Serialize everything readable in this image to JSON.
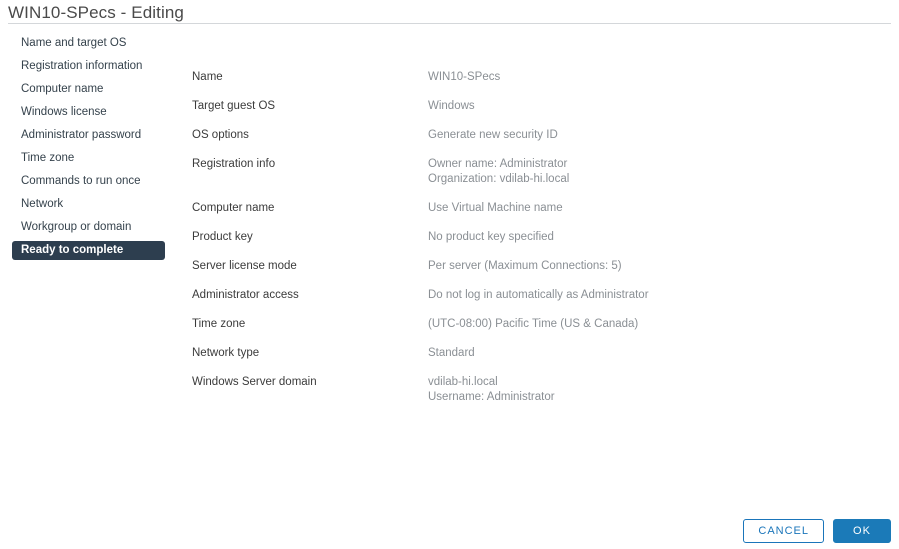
{
  "header": {
    "title": "WIN10-SPecs - Editing"
  },
  "sidebar": {
    "items": [
      {
        "label": "Name and target OS",
        "selected": false
      },
      {
        "label": "Registration information",
        "selected": false
      },
      {
        "label": "Computer name",
        "selected": false
      },
      {
        "label": "Windows license",
        "selected": false
      },
      {
        "label": "Administrator password",
        "selected": false
      },
      {
        "label": "Time zone",
        "selected": false
      },
      {
        "label": "Commands to run once",
        "selected": false
      },
      {
        "label": "Network",
        "selected": false
      },
      {
        "label": "Workgroup or domain",
        "selected": false
      },
      {
        "label": "Ready to complete",
        "selected": true
      }
    ]
  },
  "summary": {
    "rows": [
      {
        "label": "Name",
        "value": "WIN10-SPecs",
        "value2": ""
      },
      {
        "label": "Target guest OS",
        "value": "Windows",
        "value2": ""
      },
      {
        "label": "OS options",
        "value": "Generate new security ID",
        "value2": ""
      },
      {
        "label": "Registration info",
        "value": "Owner name: Administrator",
        "value2": "Organization: vdilab-hi.local"
      },
      {
        "label": "Computer name",
        "value": "Use Virtual Machine name",
        "value2": ""
      },
      {
        "label": "Product key",
        "value": "No product key specified",
        "value2": ""
      },
      {
        "label": "Server license mode",
        "value": "Per server (Maximum Connections: 5)",
        "value2": ""
      },
      {
        "label": "Administrator access",
        "value": "Do not log in automatically as Administrator",
        "value2": ""
      },
      {
        "label": "Time zone",
        "value": "(UTC-08:00) Pacific Time (US & Canada)",
        "value2": ""
      },
      {
        "label": "Network type",
        "value": "Standard",
        "value2": ""
      },
      {
        "label": "Windows Server domain",
        "value": "vdilab-hi.local",
        "value2": "Username: Administrator"
      }
    ]
  },
  "footer": {
    "cancel_label": "CANCEL",
    "ok_label": "OK"
  },
  "colors": {
    "primary": "#1b7ab8",
    "selected_nav": "#2d3e4f",
    "label_text": "#3b3b3b",
    "value_text": "#8a8f94"
  }
}
